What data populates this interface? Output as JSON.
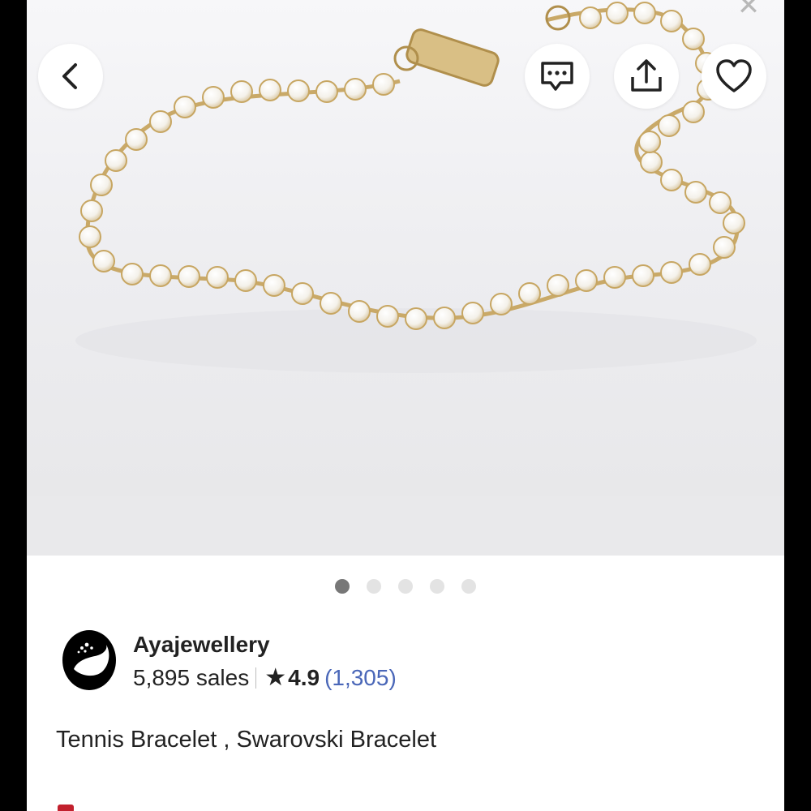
{
  "product": {
    "image_alt": "Gold tennis bracelet with clear crystals on white background",
    "title": "Tennis Bracelet , Swarovski Bracelet",
    "image_count": 5,
    "active_image_index": 0
  },
  "header": {
    "back_icon": "chevron-left-icon",
    "message_icon": "message-icon",
    "share_icon": "share-icon",
    "favorite_icon": "heart-icon",
    "close_glyph": "✕"
  },
  "shop": {
    "name": "Ayajewellery",
    "sales": "5,895 sales",
    "rating": "4.9",
    "reviews": "(1,305)",
    "star_glyph": "★"
  },
  "colors": {
    "reviews_link": "#4a67b8",
    "dot_active": "#777777",
    "dot_inactive": "#e3e3e3"
  }
}
